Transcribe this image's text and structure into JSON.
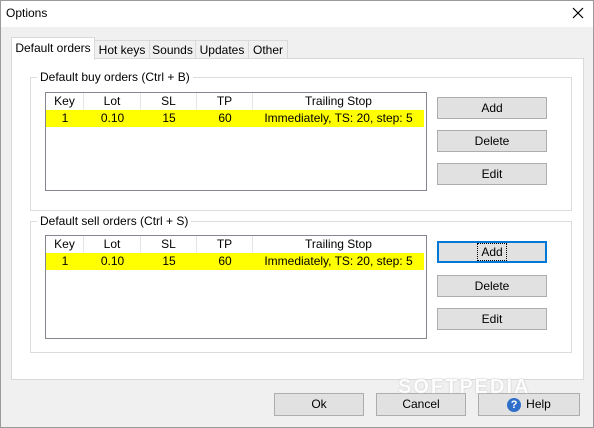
{
  "window": {
    "title": "Options"
  },
  "tabs": [
    {
      "label": "Default orders",
      "active": true
    },
    {
      "label": "Hot keys",
      "active": false
    },
    {
      "label": "Sounds",
      "active": false
    },
    {
      "label": "Updates",
      "active": false
    },
    {
      "label": "Other",
      "active": false
    }
  ],
  "buy_group": {
    "label": "Default buy orders (Ctrl + B)",
    "columns": [
      "Key",
      "Lot",
      "SL",
      "TP",
      "Trailing Stop"
    ],
    "rows": [
      [
        "1",
        "0.10",
        "15",
        "60",
        "Immediately, TS: 20, step: 5"
      ]
    ],
    "buttons": {
      "add": "Add",
      "delete": "Delete",
      "edit": "Edit"
    }
  },
  "sell_group": {
    "label": "Default sell orders (Ctrl + S)",
    "columns": [
      "Key",
      "Lot",
      "SL",
      "TP",
      "Trailing Stop"
    ],
    "rows": [
      [
        "1",
        "0.10",
        "15",
        "60",
        "Immediately, TS: 20, step: 5"
      ]
    ],
    "buttons": {
      "add": "Add",
      "delete": "Delete",
      "edit": "Edit"
    }
  },
  "footer": {
    "ok": "Ok",
    "cancel": "Cancel",
    "help": "Help"
  },
  "icons": {
    "close": "close-icon",
    "help": "help-icon"
  },
  "colors": {
    "selected_row": "#ffff00",
    "focus_border": "#0078d7"
  },
  "watermark": "SOFTPEDIA"
}
